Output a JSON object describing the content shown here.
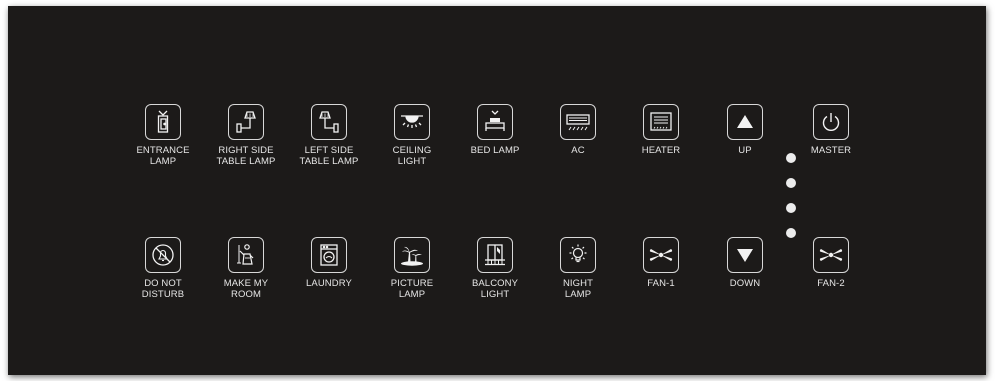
{
  "top_row": [
    {
      "icon": "entrance-lamp-icon",
      "label": [
        "ENTRANCE",
        "LAMP"
      ]
    },
    {
      "icon": "right-side-table-lamp-icon",
      "label": [
        "RIGHT SIDE",
        "TABLE LAMP"
      ]
    },
    {
      "icon": "left-side-table-lamp-icon",
      "label": [
        "LEFT SIDE",
        "TABLE LAMP"
      ]
    },
    {
      "icon": "ceiling-light-icon",
      "label": [
        "CEILING",
        "LIGHT"
      ]
    },
    {
      "icon": "bed-lamp-icon",
      "label": [
        "BED LAMP"
      ]
    },
    {
      "icon": "ac-icon",
      "label": [
        "AC"
      ]
    },
    {
      "icon": "heater-icon",
      "label": [
        "HEATER"
      ]
    },
    {
      "icon": "up-arrow-icon",
      "label": [
        "UP"
      ]
    },
    {
      "icon": "power-icon",
      "label": [
        "MASTER"
      ]
    }
  ],
  "bottom_row": [
    {
      "icon": "do-not-disturb-icon",
      "label": [
        "DO NOT",
        "DISTURB"
      ]
    },
    {
      "icon": "make-my-room-icon",
      "label": [
        "MAKE MY",
        "ROOM"
      ]
    },
    {
      "icon": "laundry-icon",
      "label": [
        "LAUNDRY"
      ]
    },
    {
      "icon": "picture-lamp-icon",
      "label": [
        "PICTURE",
        "LAMP"
      ]
    },
    {
      "icon": "balcony-light-icon",
      "label": [
        "BALCONY",
        "LIGHT"
      ]
    },
    {
      "icon": "night-lamp-icon",
      "label": [
        "NIGHT",
        "LAMP"
      ]
    },
    {
      "icon": "fan-icon",
      "label": [
        "FAN-1"
      ]
    },
    {
      "icon": "down-arrow-icon",
      "label": [
        "DOWN"
      ]
    },
    {
      "icon": "fan-icon",
      "label": [
        "FAN-2"
      ]
    }
  ],
  "fan_speed_indicator": {
    "levels": 4
  },
  "colors": {
    "panel": "#1c1a19",
    "icon": "#f2f2f2",
    "text": "#e6e6e6",
    "led": "#ececec"
  }
}
